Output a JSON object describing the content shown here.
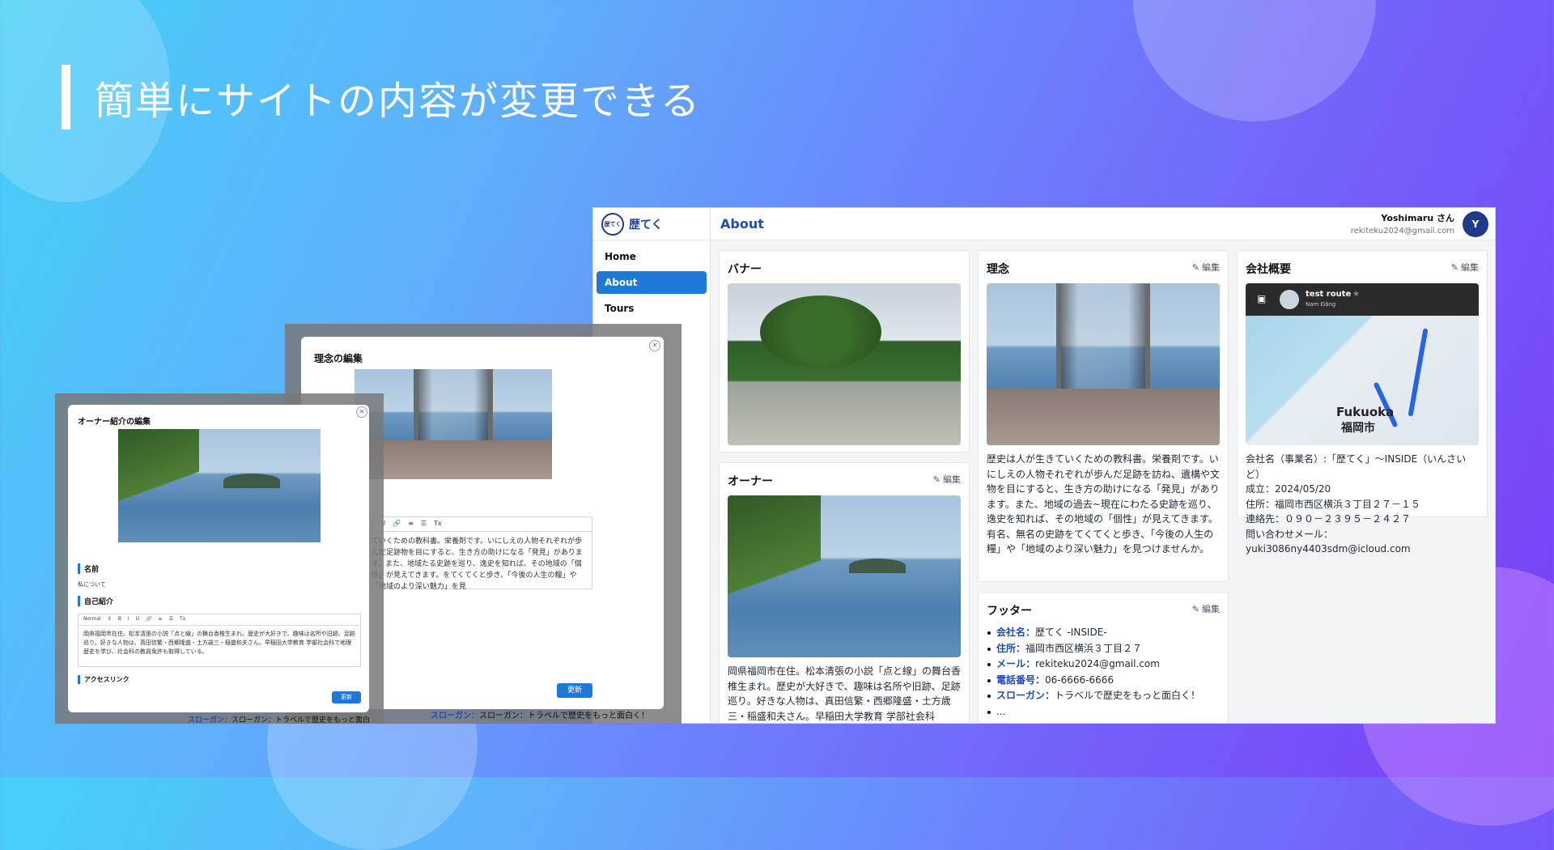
{
  "headline": "簡単にサイトの内容が変更できる",
  "brand": {
    "logo_text": "歴てく",
    "name": "歴てく"
  },
  "nav": {
    "items": [
      "Home",
      "About",
      "Tours"
    ]
  },
  "page_title": "About",
  "user": {
    "name": "Yoshimaru さん",
    "email": "rekiteku2024@gmail.com",
    "initial": "Y"
  },
  "edit_label": "編集",
  "banner": {
    "title": "バナー"
  },
  "owner": {
    "title": "オーナー",
    "text": "岡県福岡市在住。松本清張の小説「点と線」の舞台香椎生まれ。歴史が大好きで、趣味は名所や旧跡、足跡巡り。好きな人物は、真田信繁・西郷隆盛・土方歳三・稲盛和夫さん。早稲田大学教育 学部社会科"
  },
  "philosophy": {
    "title": "理念",
    "text": "歴史は人が生きていくための教科書。栄養剤です。いにしえの人物それぞれが歩んだ足跡を訪ね、遺構や文物を目にすると、生き方の助けになる「発見」があります。また、地域の過去~現在にわたる史跡を巡り、逸史を知れば、その地域の「個性」が見えてきます。有名、無名の史跡をてくてくと歩き、「今後の人生の糧」や「地域のより深い魅力」を見つけませんか。"
  },
  "company": {
    "title": "会社概要",
    "map": {
      "route_name": "test route",
      "user": "Nam Đặng",
      "city_en": "Fukuoka",
      "city_ja": "福岡市"
    },
    "lines": [
      "会社名（事業名）:「歴てく」～INSIDE（いんさいど）",
      "成立：2024/05/20",
      "住所：福岡市西区横浜３丁目２７－１５",
      "連絡先：０９０－２３９５－２４２７",
      "問い合わせメール：",
      "yuki3086ny4403sdm@icloud.com"
    ]
  },
  "footer": {
    "title": "フッター",
    "items": [
      {
        "key": "会社名：",
        "value": "歴てく -INSIDE-"
      },
      {
        "key": "住所：",
        "value": "福岡市西区横浜３丁目２７"
      },
      {
        "key": "メール：",
        "value": "rekiteku2024@gmail.com"
      },
      {
        "key": "電話番号：",
        "value": "06-6666-6666"
      },
      {
        "key": "スローガン：",
        "value": "トラベルで歴史をもっと面白く！"
      },
      {
        "key": "",
        "value": "..."
      }
    ]
  },
  "modal_philosophy": {
    "title": "理念の編集",
    "toolbar": [
      "I",
      "U",
      "🔗",
      "≡",
      "☰",
      "Tx"
    ],
    "text": "ていくための教科書。栄養剤です。いにしえの人物それぞれが歩んだ足跡物を目にすると、生き方の助けになる「発見」があります。また、地域たる史跡を巡り、逸史を知れば、その地域の「個性」が見えてきます。をてくてくと歩き、「今後の人生の糧」や「地域のより深い魅力」を見",
    "update": "更新",
    "behind_text": "スローガン：トラベルで歴史をもっと面白く！"
  },
  "modal_owner": {
    "title": "オーナー紹介の編集",
    "name_label": "名前",
    "name_value": "私について",
    "intro_label": "自己紹介",
    "toolbar": [
      "Normal",
      "⇕",
      "B",
      "I",
      "U",
      "🔗",
      "≡",
      "☰",
      "Tx"
    ],
    "intro_text": "岡県福岡市在住。松本清張の小説「点と線」の舞台香椎生まれ。歴史が大好きで、趣味は名所や旧跡、足跡巡り。好きな人物は、真田信繁・西郷隆盛・土方歳三・稲盛和夫さん。早稲田大学教育 学部社会科で地理歴史を学び、社会科の教員免許も取得している。",
    "access_label": "アクセスリンク",
    "update": "更新",
    "behind_text": "スローガン：トラベルで歴史をもっと面白く！"
  }
}
